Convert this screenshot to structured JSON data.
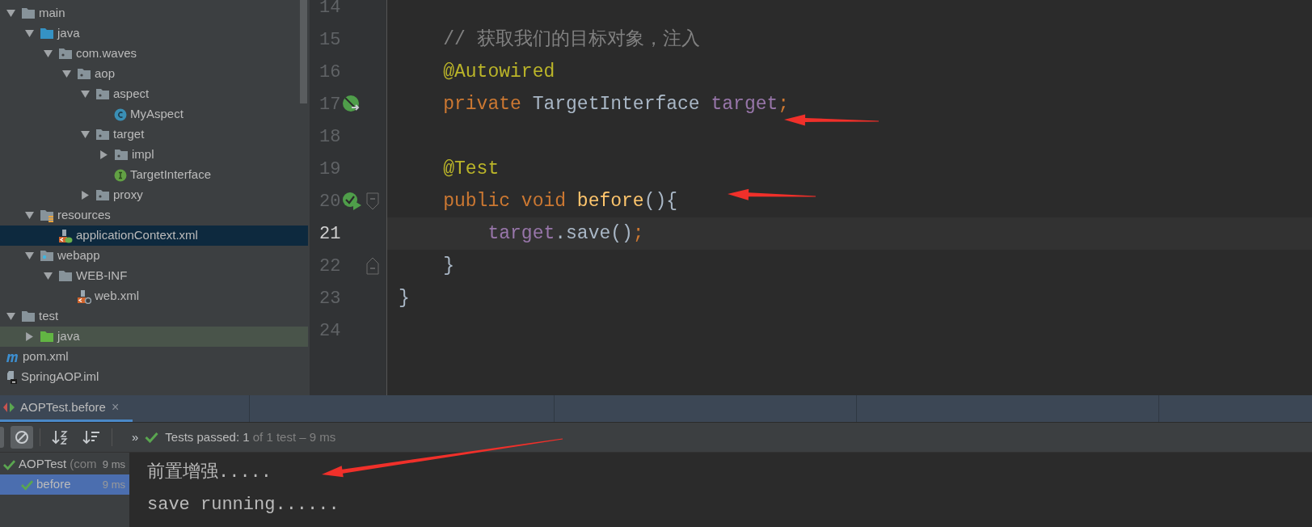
{
  "project_tree": [
    {
      "label": "main",
      "kind": "folder",
      "expanded": true,
      "selected": false,
      "children": [
        {
          "label": "java",
          "kind": "source-folder",
          "expanded": true,
          "selected": false,
          "children": [
            {
              "label": "com.waves",
              "kind": "package",
              "expanded": true,
              "selected": false,
              "children": [
                {
                  "label": "aop",
                  "kind": "package",
                  "expanded": true,
                  "selected": false,
                  "children": [
                    {
                      "label": "aspect",
                      "kind": "package",
                      "expanded": true,
                      "selected": false,
                      "children": [
                        {
                          "label": "MyAspect",
                          "kind": "class",
                          "selected": false
                        }
                      ]
                    },
                    {
                      "label": "target",
                      "kind": "package",
                      "expanded": true,
                      "selected": false,
                      "children": [
                        {
                          "label": "impl",
                          "kind": "package",
                          "expanded": false,
                          "selected": false
                        },
                        {
                          "label": "TargetInterface",
                          "kind": "interface",
                          "selected": false
                        }
                      ]
                    },
                    {
                      "label": "proxy",
                      "kind": "package",
                      "expanded": false,
                      "selected": false
                    }
                  ]
                }
              ]
            }
          ]
        },
        {
          "label": "resources",
          "kind": "resources",
          "expanded": true,
          "selected": false,
          "children": [
            {
              "label": "applicationContext.xml",
              "kind": "spring-xml",
              "selected": true
            }
          ]
        },
        {
          "label": "webapp",
          "kind": "web-folder",
          "expanded": true,
          "selected": false,
          "children": [
            {
              "label": "WEB-INF",
              "kind": "folder",
              "expanded": true,
              "selected": false,
              "children": [
                {
                  "label": "web.xml",
                  "kind": "web-xml",
                  "selected": false
                }
              ]
            }
          ]
        }
      ]
    },
    {
      "label": "test",
      "kind": "folder",
      "expanded": true,
      "selected": false,
      "children": [
        {
          "label": "java",
          "kind": "test-folder",
          "expanded": false,
          "selected": false
        }
      ]
    },
    {
      "label": "pom.xml",
      "kind": "maven",
      "selected": false
    },
    {
      "label": "SpringAOP.iml",
      "kind": "iml",
      "selected": false
    }
  ],
  "code_lines": [
    {
      "number": "14",
      "current": false,
      "kind": "blank"
    },
    {
      "number": "15",
      "current": false,
      "kind": "code",
      "tokens": [
        {
          "text": "    // 获取我们的目标对象，注入",
          "kind": "comment"
        }
      ]
    },
    {
      "number": "16",
      "current": false,
      "kind": "code",
      "tokens": [
        {
          "text": "    @Autowired",
          "kind": "annotation"
        }
      ]
    },
    {
      "number": "17",
      "current": false,
      "kind": "field",
      "tokens": [
        {
          "text": "    private ",
          "kind": "keyword"
        },
        {
          "text": "TargetInterface ",
          "kind": "plain"
        },
        {
          "text": "target",
          "kind": "field"
        },
        {
          "text": ";",
          "kind": "keyword"
        }
      ]
    },
    {
      "number": "18",
      "current": false,
      "kind": "blank"
    },
    {
      "number": "19",
      "current": false,
      "kind": "code",
      "tokens": [
        {
          "text": "    @Test",
          "kind": "annotation"
        }
      ]
    },
    {
      "number": "20",
      "current": false,
      "kind": "test-method",
      "tokens": [
        {
          "text": "    public void ",
          "kind": "keyword"
        },
        {
          "text": "before",
          "kind": "method"
        },
        {
          "text": "(){",
          "kind": "plain"
        }
      ]
    },
    {
      "number": "21",
      "current": true,
      "kind": "code",
      "tokens": [
        {
          "text": "        target",
          "kind": "field"
        },
        {
          "text": ".save()",
          "kind": "plain"
        },
        {
          "text": ";",
          "kind": "keyword"
        }
      ]
    },
    {
      "number": "22",
      "current": false,
      "kind": "block-end",
      "tokens": [
        {
          "text": "    }",
          "kind": "plain"
        }
      ]
    },
    {
      "number": "23",
      "current": false,
      "kind": "code",
      "tokens": [
        {
          "text": "}",
          "kind": "plain"
        }
      ]
    },
    {
      "number": "24",
      "current": false,
      "kind": "blank"
    }
  ],
  "run_panel": {
    "tab": {
      "label": "AOPTest.before",
      "selected": true,
      "close": "×"
    },
    "more": "»",
    "status": {
      "passed": "Tests passed: 1",
      "rest": " of 1 test – 9 ms"
    },
    "tests": [
      {
        "label": "AOPTest",
        "detail": "(com",
        "time": "9 ms",
        "passed": true,
        "selected": false,
        "children": [
          {
            "label": "before",
            "time": "9 ms",
            "passed": true,
            "selected": true
          }
        ]
      }
    ],
    "console": [
      "前置增强.....",
      "save running......"
    ]
  }
}
